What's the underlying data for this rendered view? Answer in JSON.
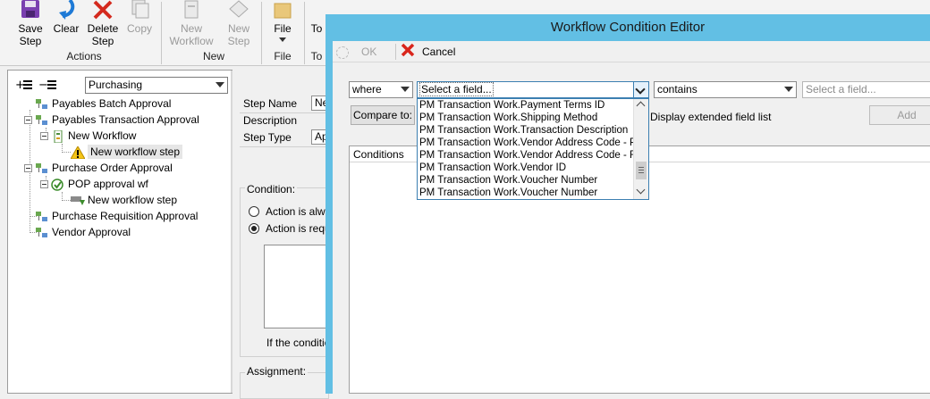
{
  "ribbon": {
    "buttons": [
      {
        "label1": "Save",
        "label2": "Step"
      },
      {
        "label1": "Clear",
        "label2": ""
      },
      {
        "label1": "Delete",
        "label2": "Step"
      },
      {
        "label1": "Copy",
        "label2": ""
      },
      {
        "label1": "New",
        "label2": "Workflow"
      },
      {
        "label1": "New",
        "label2": "Step"
      },
      {
        "label1": "File",
        "label2": ""
      },
      {
        "label1": "To",
        "label2": ""
      }
    ],
    "groups": [
      "Actions",
      "New",
      "File",
      "To"
    ]
  },
  "tree": {
    "scope_value": "Purchasing",
    "nodes": [
      "Payables Batch Approval",
      "Payables Transaction Approval",
      "New Workflow",
      "New workflow step",
      "Purchase Order Approval",
      "POP approval wf",
      "New workflow step",
      "Purchase Requisition Approval",
      "Vendor Approval"
    ]
  },
  "step": {
    "labels": [
      "Step Name",
      "Description",
      "Step Type"
    ],
    "values": [
      "Ne",
      "",
      "Ap"
    ],
    "condition_label": "Condition:",
    "radio1": "Action is alwa",
    "radio2": "Action is requi",
    "if_text": "If the conditio",
    "assignment_label": "Assignment:"
  },
  "dialog": {
    "title": "Workflow Condition Editor",
    "ok_label": "OK",
    "cancel_label": "Cancel",
    "where_value": "where",
    "field_value": "Select a field...",
    "operator_value": "contains",
    "value_placeholder": "Select a field...",
    "compare_label": "Compare to:",
    "extended_label": "Display extended field list",
    "add_label": "Add",
    "conditions_header": "Conditions",
    "field_options": [
      "PM Transaction Work.Payment Terms ID",
      "PM Transaction Work.Shipping Method",
      "PM Transaction Work.Transaction Description",
      "PM Transaction Work.Vendor Address Code - Prima",
      "PM Transaction Work.Vendor Address Code - Rem",
      "PM Transaction Work.Vendor ID",
      "PM Transaction Work.Voucher Number",
      "PM Transaction Work.Voucher Number"
    ]
  },
  "colors": {
    "dialog_frame": "#62bfe4",
    "focus_border": "#3c7fb1",
    "cancel_red": "#d9261c"
  }
}
